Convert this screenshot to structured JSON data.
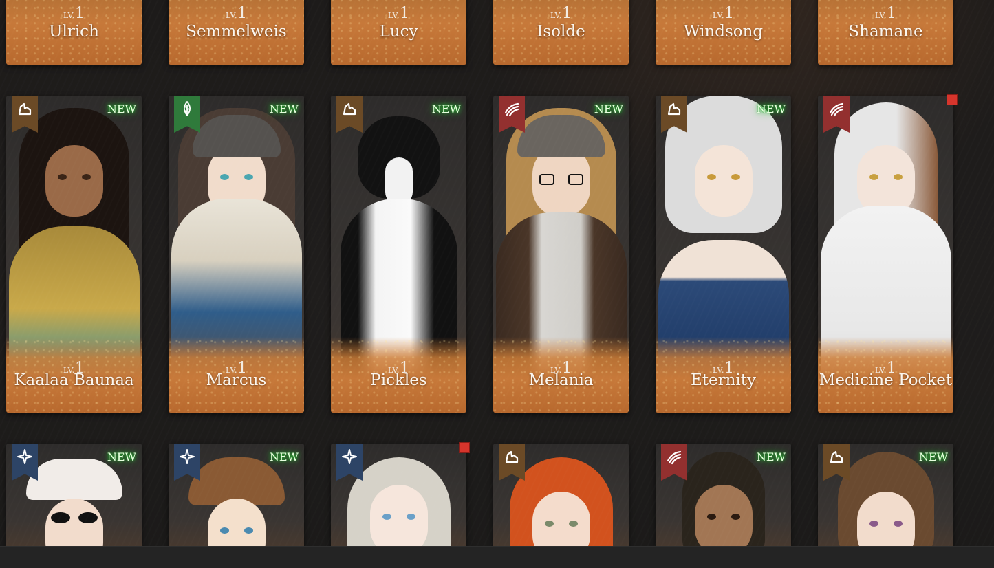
{
  "colors": {
    "badge_brown": "#6b4a26",
    "badge_green": "#2f7a3b",
    "badge_red": "#93302f",
    "badge_blue": "#2d4466",
    "name_panel": "#c7793a",
    "new_glow": "#2fd13a",
    "notify_red": "#d6352c"
  },
  "level_label": "LV.",
  "new_label": "NEW",
  "rows": [
    {
      "cards": [
        {
          "name": "Ulrich",
          "level": "1"
        },
        {
          "name": "Semmelweis",
          "level": "1"
        },
        {
          "name": "Lucy",
          "level": "1"
        },
        {
          "name": "Isolde",
          "level": "1"
        },
        {
          "name": "Windsong",
          "level": "1"
        },
        {
          "name": "Shamane",
          "level": "1"
        }
      ]
    },
    {
      "cards": [
        {
          "name": "Kaalaa Baunaa",
          "level": "1",
          "badge": "brown",
          "icon": "crystal-icon",
          "new": true
        },
        {
          "name": "Marcus",
          "level": "1",
          "badge": "green",
          "icon": "leaf-icon",
          "new": true
        },
        {
          "name": "Pickles",
          "level": "1",
          "badge": "brown",
          "icon": "crystal-icon",
          "new": true
        },
        {
          "name": "Melania",
          "level": "1",
          "badge": "red",
          "icon": "claw-icon",
          "new": true
        },
        {
          "name": "Eternity",
          "level": "1",
          "badge": "brown",
          "icon": "crystal-icon",
          "new": true
        },
        {
          "name": "Medicine Pocket",
          "level": "1",
          "badge": "red",
          "icon": "claw-icon",
          "notify": true
        }
      ]
    },
    {
      "cards": [
        {
          "badge": "blue",
          "icon": "star-icon",
          "new": true
        },
        {
          "badge": "blue",
          "icon": "star-icon",
          "new": true
        },
        {
          "badge": "blue",
          "icon": "star-icon",
          "notify": true
        },
        {
          "badge": "brown",
          "icon": "crystal-icon"
        },
        {
          "badge": "red",
          "icon": "claw-icon",
          "new": true
        },
        {
          "badge": "brown",
          "icon": "crystal-icon",
          "new": true
        }
      ]
    }
  ]
}
